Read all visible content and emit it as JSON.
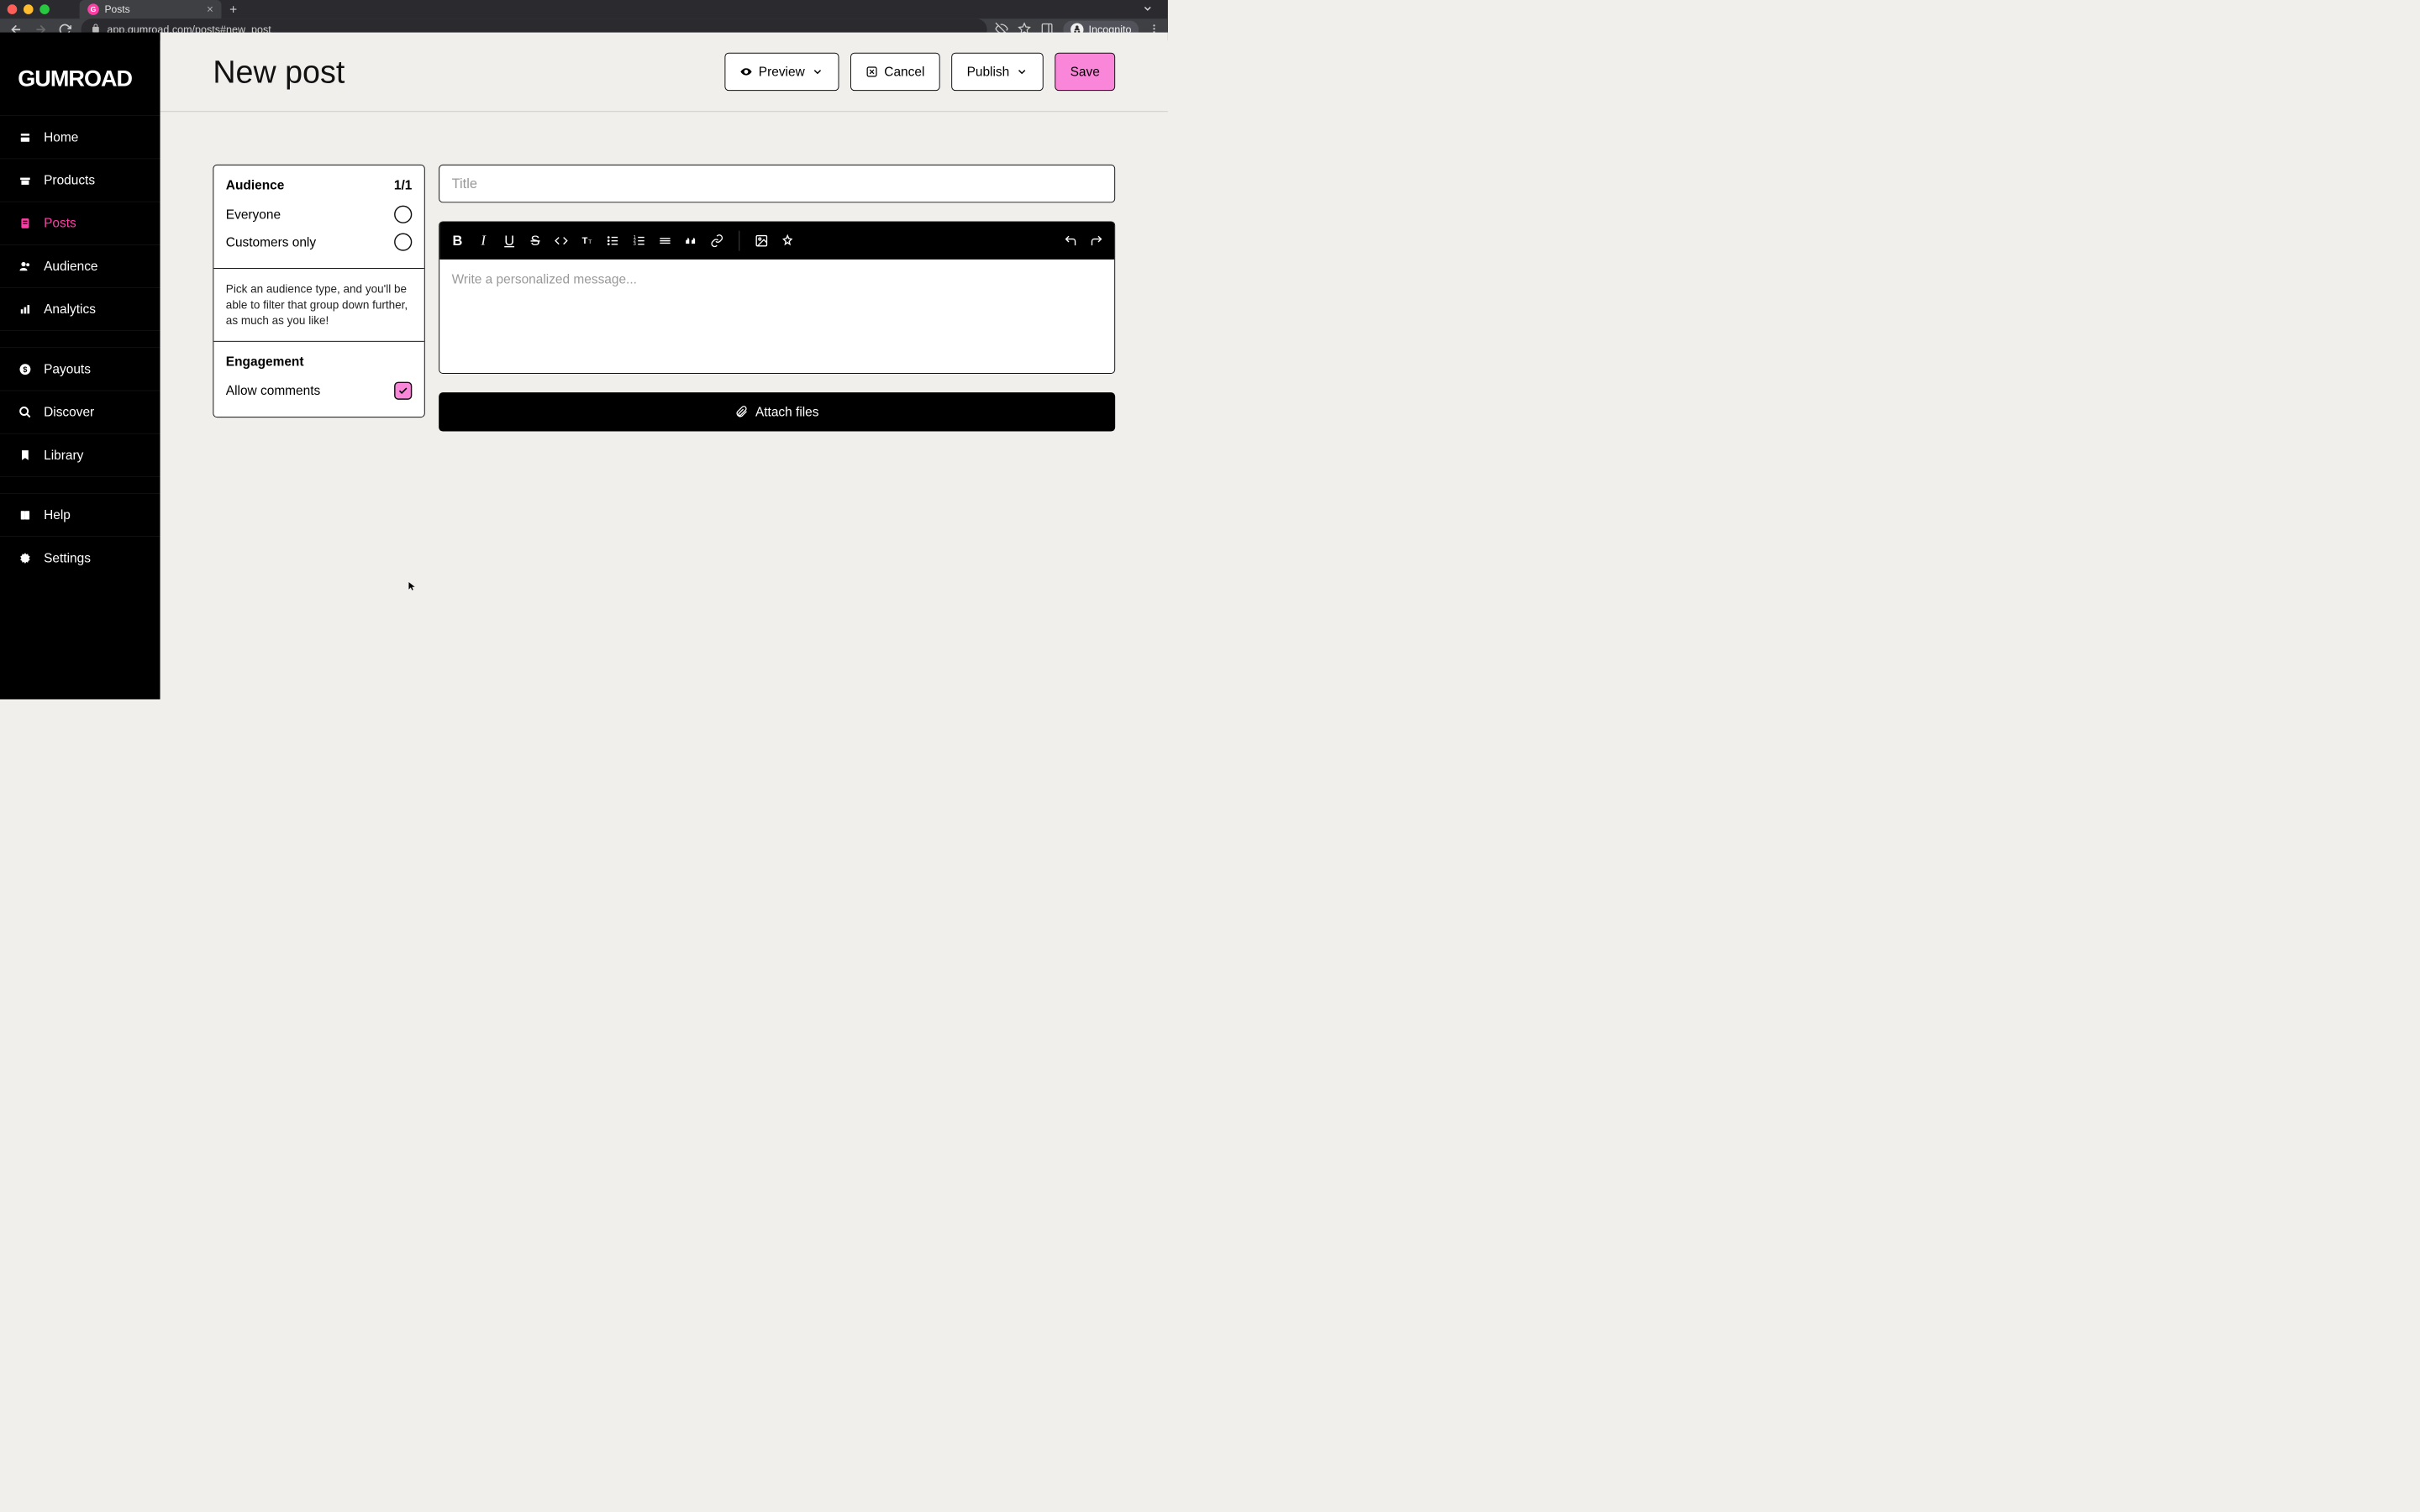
{
  "browser": {
    "tab_title": "Posts",
    "url": "app.gumroad.com/posts#new_post",
    "profile_label": "Incognito"
  },
  "sidebar": {
    "logo": "GUMROAD",
    "items": [
      {
        "label": "Home"
      },
      {
        "label": "Products"
      },
      {
        "label": "Posts"
      },
      {
        "label": "Audience"
      },
      {
        "label": "Analytics"
      },
      {
        "label": "Payouts"
      },
      {
        "label": "Discover"
      },
      {
        "label": "Library"
      },
      {
        "label": "Help"
      },
      {
        "label": "Settings"
      }
    ]
  },
  "header": {
    "title": "New post",
    "preview": "Preview",
    "cancel": "Cancel",
    "publish": "Publish",
    "save": "Save"
  },
  "panel": {
    "audience_title": "Audience",
    "audience_count": "1/1",
    "everyone": "Everyone",
    "customers_only": "Customers only",
    "helper": "Pick an audience type, and you'll be able to filter that group down further, as much as you like!",
    "engagement_title": "Engagement",
    "allow_comments": "Allow comments"
  },
  "editor": {
    "title_placeholder": "Title",
    "body_placeholder": "Write a personalized message...",
    "attach": "Attach files"
  }
}
